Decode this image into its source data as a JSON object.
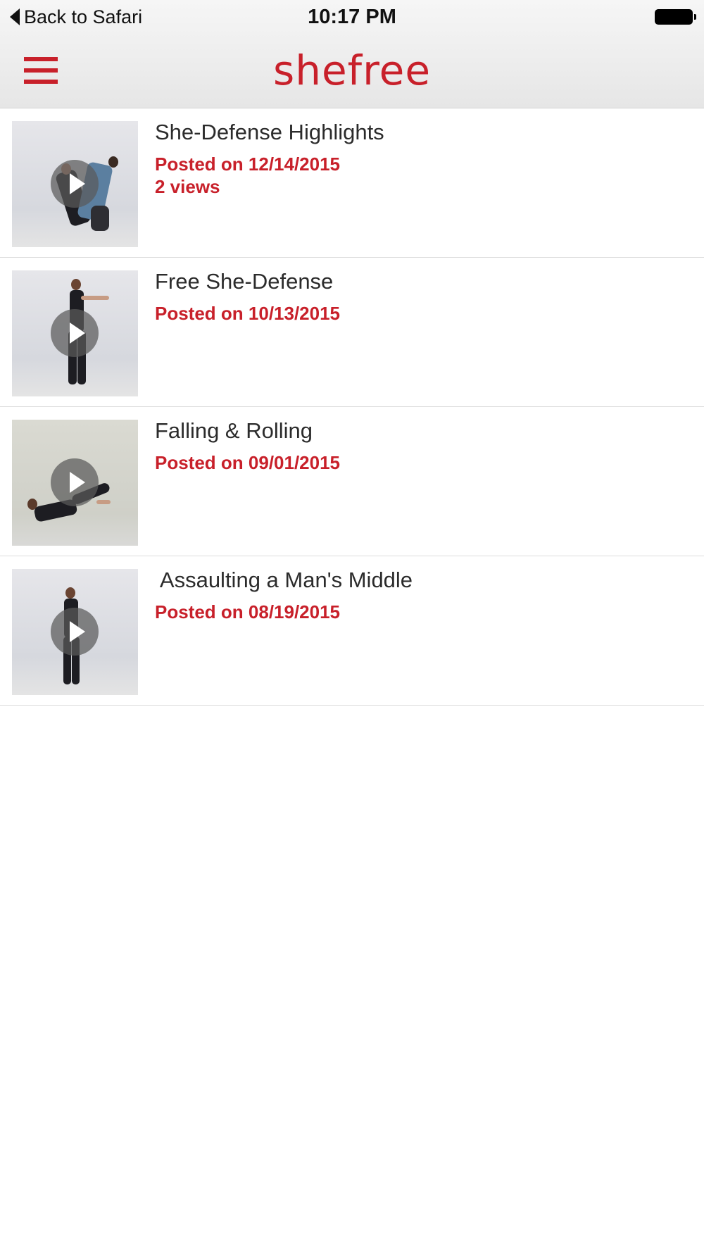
{
  "status_bar": {
    "back_label": "Back to Safari",
    "time": "10:17 PM"
  },
  "nav": {
    "brand": "shefree",
    "brand_color": "#c8202a"
  },
  "videos": [
    {
      "title": "She-Defense Highlights",
      "posted": "Posted on 12/14/2015",
      "views": "2 views",
      "thumbnail": "two-people-grappling"
    },
    {
      "title": "Free She-Defense",
      "posted": "Posted on 10/13/2015",
      "thumbnail": "woman-standing-arm-extended"
    },
    {
      "title": "Falling & Rolling",
      "posted": "Posted on 09/01/2015",
      "thumbnail": "woman-rolling-on-floor"
    },
    {
      "title": " Assaulting a Man's Middle",
      "posted": "Posted on 08/19/2015",
      "thumbnail": "woman-standing-front"
    }
  ]
}
